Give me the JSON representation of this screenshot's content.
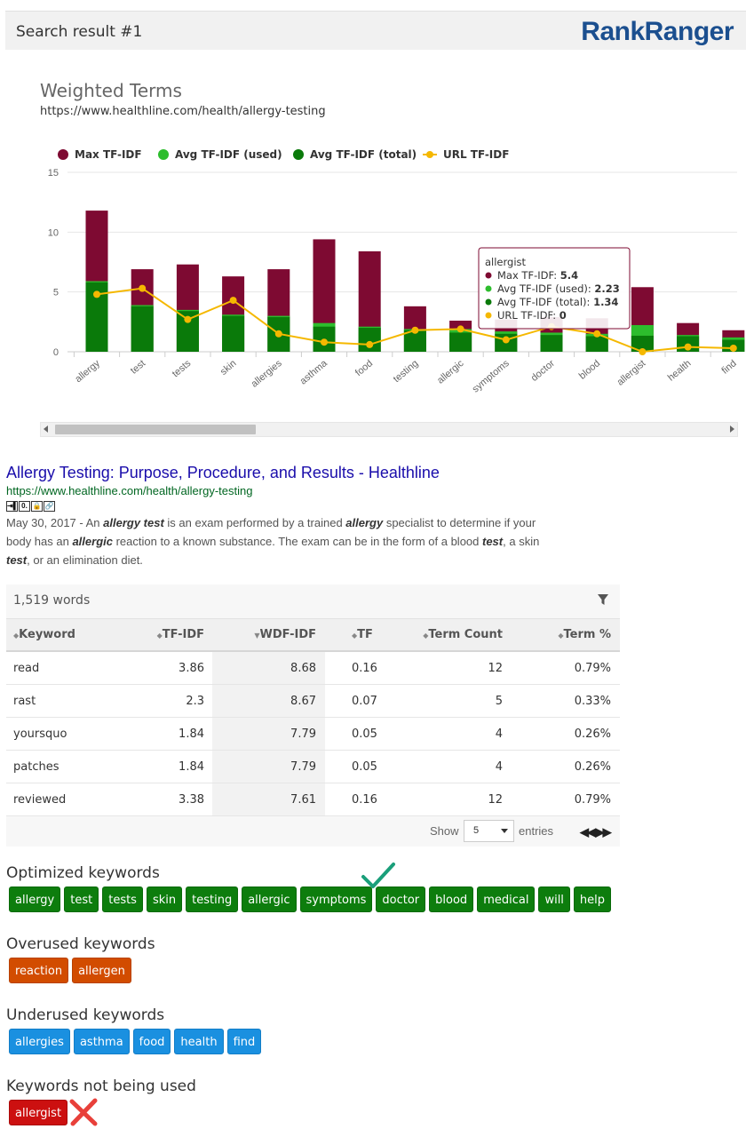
{
  "header": {
    "title": "Search result #1",
    "logo_part1": "Rank",
    "logo_part2": "Ranger"
  },
  "chart": {
    "title": "Weighted Terms",
    "url": "https://www.healthline.com/health/allergy-testing"
  },
  "chart_data": {
    "type": "bar",
    "categories": [
      "allergy",
      "test",
      "tests",
      "skin",
      "allergies",
      "asthma",
      "food",
      "testing",
      "allergic",
      "symptoms",
      "doctor",
      "blood",
      "allergist",
      "health",
      "find"
    ],
    "series": [
      {
        "name": "Max TF-IDF",
        "color": "#7e0a32",
        "values": [
          11.8,
          6.9,
          7.3,
          6.3,
          6.9,
          9.4,
          8.4,
          3.8,
          2.6,
          2.7,
          2.9,
          2.8,
          5.4,
          2.4,
          1.8
        ]
      },
      {
        "name": "Avg TF-IDF (used)",
        "color": "#2dbd2d",
        "values": [
          5.9,
          3.9,
          3.5,
          3.1,
          3.0,
          2.4,
          2.1,
          1.9,
          1.9,
          1.7,
          1.6,
          1.5,
          2.23,
          1.4,
          1.2
        ]
      },
      {
        "name": "Avg TF-IDF (total)",
        "color": "#0a7a0a",
        "values": [
          5.8,
          3.8,
          3.4,
          3.0,
          2.9,
          2.1,
          2.0,
          1.8,
          1.6,
          1.5,
          1.4,
          1.3,
          1.34,
          1.3,
          1.0
        ]
      },
      {
        "name": "URL TF-IDF",
        "color": "#f5b800",
        "values": [
          4.8,
          5.3,
          2.7,
          4.3,
          1.5,
          0.8,
          0.6,
          1.8,
          1.9,
          1.0,
          2.1,
          1.5,
          0.0,
          0.4,
          0.3
        ]
      }
    ],
    "ylim": [
      0,
      15
    ],
    "yticks": [
      "0",
      "5",
      "10",
      "15"
    ],
    "tooltip": {
      "title": "allergist",
      "rows": [
        {
          "label": "Max TF-IDF: ",
          "value": "5.4",
          "color": "#7e0a32"
        },
        {
          "label": "Avg TF-IDF (used): ",
          "value": "2.23",
          "color": "#2dbd2d"
        },
        {
          "label": "Avg TF-IDF (total): ",
          "value": "1.34",
          "color": "#0a7a0a"
        },
        {
          "label": "URL TF-IDF: ",
          "value": "0",
          "color": "#f5b800"
        }
      ]
    },
    "legend_position": "top-left",
    "grid": true
  },
  "serp": {
    "title": "Allergy Testing: Purpose, Procedure, and Results - Healthline",
    "url": "https://www.healthline.com/health/allergy-testing",
    "icons": [
      "⇥▌",
      "0.",
      "🔒",
      "🔗"
    ],
    "date": "May 30, 2017 - ",
    "s1": "An ",
    "b1": "allergy test",
    "s2": " is an exam performed by a trained ",
    "b2": "allergy",
    "s3": " specialist to determine if your body has an ",
    "b3": "allergic",
    "s4": " reaction to a known substance. The exam can be in the form of a blood ",
    "b4": "test",
    "s5": ", a skin ",
    "b5": "test",
    "s6": ", or an elimination diet."
  },
  "table": {
    "words": "1,519 words",
    "headers": {
      "keyword": "Keyword",
      "tfidf": "TF-IDF",
      "wdfidf": "WDF-IDF",
      "tf": "TF",
      "count": "Term Count",
      "pct": "Term %"
    },
    "rows": [
      {
        "keyword": "read",
        "tfidf": "3.86",
        "wdfidf": "8.68",
        "tf": "0.16",
        "count": "12",
        "pct": "0.79%"
      },
      {
        "keyword": "rast",
        "tfidf": "2.3",
        "wdfidf": "8.67",
        "tf": "0.07",
        "count": "5",
        "pct": "0.33%"
      },
      {
        "keyword": "yoursquo",
        "tfidf": "1.84",
        "wdfidf": "7.79",
        "tf": "0.05",
        "count": "4",
        "pct": "0.26%"
      },
      {
        "keyword": "patches",
        "tfidf": "1.84",
        "wdfidf": "7.79",
        "tf": "0.05",
        "count": "4",
        "pct": "0.26%"
      },
      {
        "keyword": "reviewed",
        "tfidf": "3.38",
        "wdfidf": "7.61",
        "tf": "0.16",
        "count": "12",
        "pct": "0.79%"
      }
    ],
    "show_label": "Show",
    "show_value": "5",
    "entries_label": "entries"
  },
  "keywords": {
    "optimized": {
      "title": "Optimized keywords",
      "items": [
        "allergy",
        "test",
        "tests",
        "skin",
        "testing",
        "allergic",
        "symptoms",
        "doctor",
        "blood",
        "medical",
        "will",
        "help"
      ]
    },
    "overused": {
      "title": "Overused keywords",
      "items": [
        "reaction",
        "allergen"
      ]
    },
    "underused": {
      "title": "Underused keywords",
      "items": [
        "allergies",
        "asthma",
        "food",
        "health",
        "find"
      ]
    },
    "unused": {
      "title": "Keywords not being used",
      "items": [
        "allergist"
      ]
    }
  }
}
